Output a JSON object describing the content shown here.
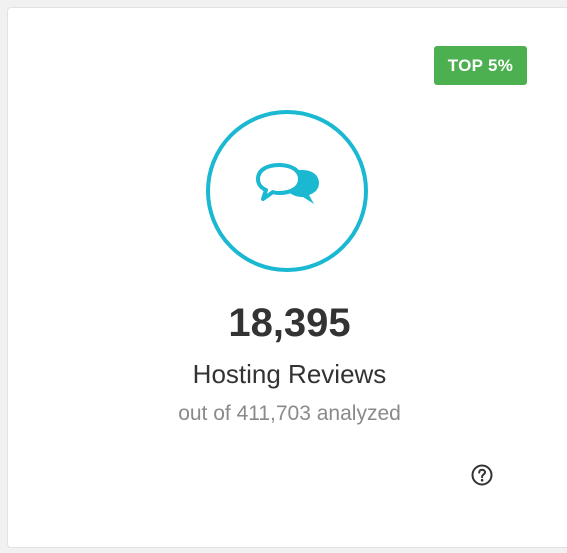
{
  "card": {
    "badge": "TOP 5%",
    "icon": "chat-bubbles-icon",
    "count": "18,395",
    "label": "Hosting Reviews",
    "subtitle": "out of 411,703 analyzed",
    "help_icon": "question-circle-icon"
  },
  "colors": {
    "badge_bg": "#4caf50",
    "accent": "#1ab8d1",
    "text_primary": "#333333",
    "text_muted": "#8a8a8a"
  }
}
